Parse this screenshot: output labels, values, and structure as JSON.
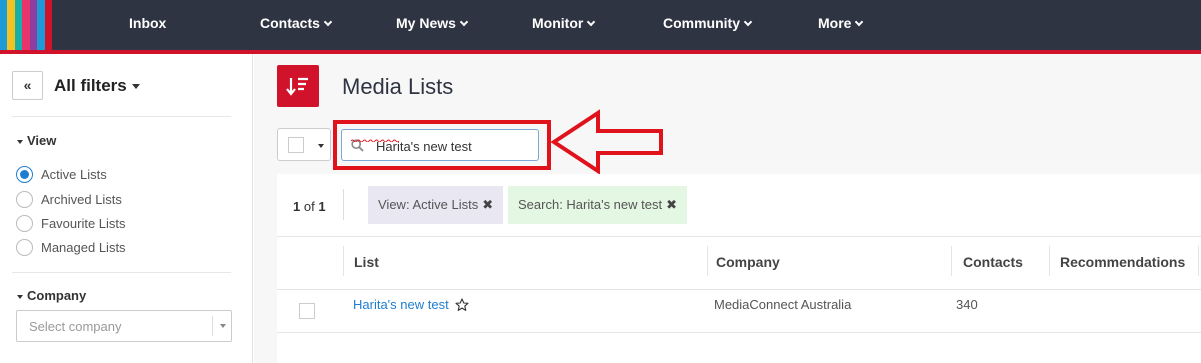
{
  "nav": {
    "items": [
      {
        "label": "Inbox",
        "dropdown": false
      },
      {
        "label": "Contacts",
        "dropdown": true
      },
      {
        "label": "My News",
        "dropdown": true
      },
      {
        "label": "Monitor",
        "dropdown": true
      },
      {
        "label": "Community",
        "dropdown": true
      },
      {
        "label": "More",
        "dropdown": true
      }
    ],
    "colors": {
      "bar": "#2f3442",
      "accent": "#d0122a"
    }
  },
  "sidebar": {
    "collapse_label": "«",
    "title": "All filters",
    "view_section": {
      "title": "View",
      "options": [
        {
          "label": "Active Lists",
          "selected": true
        },
        {
          "label": "Archived Lists",
          "selected": false
        },
        {
          "label": "Favourite Lists",
          "selected": false
        },
        {
          "label": "Managed Lists",
          "selected": false
        }
      ]
    },
    "company_section": {
      "title": "Company",
      "select_placeholder": "Select company"
    }
  },
  "main": {
    "title": "Media Lists",
    "title_icon": "sort-icon",
    "search": {
      "value": "Harita's new test",
      "icon": "search-icon"
    },
    "pager": {
      "current": "1",
      "of_label": "of",
      "total": "1"
    },
    "chips": [
      {
        "label": "View: Active Lists",
        "color": "#e9e7f1"
      },
      {
        "label": "Search: Harita's new test",
        "color": "#e3f7e2"
      }
    ],
    "table": {
      "columns": [
        "List",
        "Company",
        "Contacts",
        "Recommendations"
      ],
      "rows": [
        {
          "list": "Harita's new test",
          "company": "MediaConnect Australia",
          "contacts": "340",
          "recommendations": "",
          "favourite_icon": "star-outline-icon"
        }
      ]
    }
  }
}
